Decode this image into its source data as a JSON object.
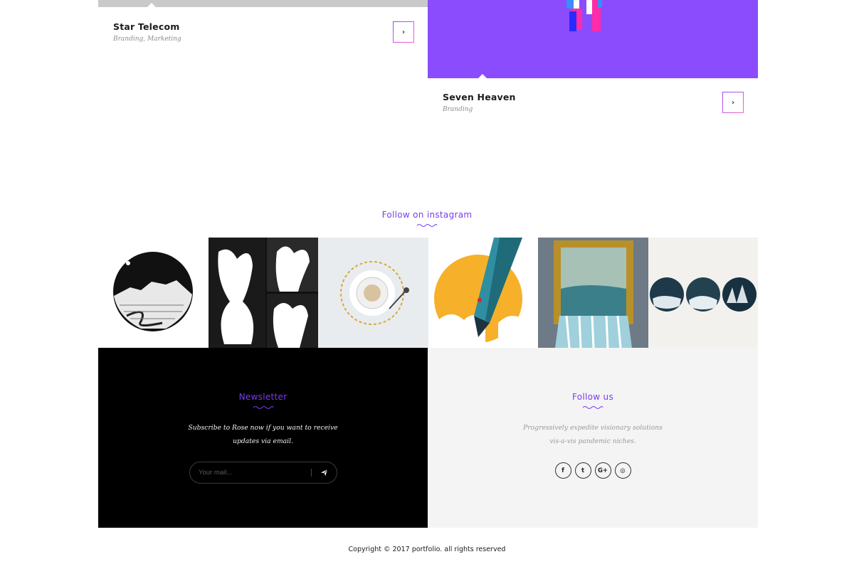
{
  "projects": [
    {
      "title": "Star Telecom",
      "tags": "Branding, Marketing",
      "arrow": "›"
    },
    {
      "title": "Seven Heaven",
      "tags": "Branding",
      "arrow": "›"
    }
  ],
  "instagram": {
    "heading": "Follow on instagram",
    "tiles": [
      "landscape-circle-art",
      "silhouette-collage",
      "coffee-cup-art",
      "pencil-balloon-art",
      "framed-waterfall-art",
      "three-circles-art"
    ]
  },
  "newsletter": {
    "title": "Newsletter",
    "text_line1": "Subscribe to Rose now if you want to receive",
    "text_line2": "updates via email.",
    "placeholder": "Your mail...",
    "send_icon": "paper-plane-icon"
  },
  "follow_us": {
    "title": "Follow us",
    "text_line1": "Progressively expedite visionary solutions",
    "text_line2": "vis-a-vis pandemic niches.",
    "socials": [
      {
        "icon": "facebook-icon",
        "glyph": "f"
      },
      {
        "icon": "twitter-icon",
        "glyph": "t"
      },
      {
        "icon": "google-plus-icon",
        "glyph": "G+"
      },
      {
        "icon": "instagram-icon",
        "glyph": "◎"
      }
    ]
  },
  "footer": {
    "copyright": "Copyright © 2017 portfolio. all rights reserved"
  },
  "colors": {
    "accent": "#7a3cf0",
    "card_purple": "#8a4cfc",
    "dark": "#000000",
    "light_block": "#f4f4f4"
  }
}
